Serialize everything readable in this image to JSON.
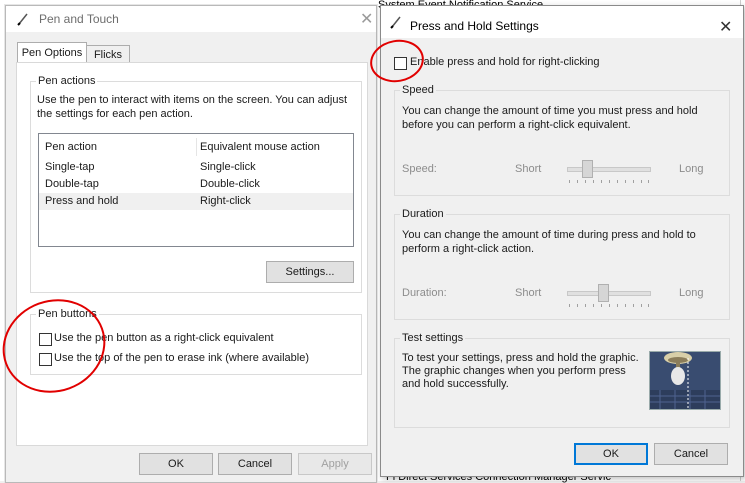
{
  "background": {
    "item_top": "System Event Notification Service",
    "item_bottom": "Fi Direct Services Connection Manager Servic"
  },
  "pen_touch": {
    "title": "Pen and Touch",
    "tabs": [
      "Pen Options",
      "Flicks"
    ],
    "pen_actions": {
      "label": "Pen actions",
      "description": "Use the pen to interact with items on the screen.  You can adjust the settings for each pen action.",
      "columns": [
        "Pen action",
        "Equivalent mouse action"
      ],
      "rows": [
        {
          "action": "Single-tap",
          "mouse": "Single-click"
        },
        {
          "action": "Double-tap",
          "mouse": "Double-click"
        },
        {
          "action": "Press and hold",
          "mouse": "Right-click"
        }
      ],
      "settings_button": "Settings..."
    },
    "pen_buttons": {
      "label": "Pen buttons",
      "option1": "Use the pen button as a right-click equivalent",
      "option2": "Use the top of the pen to erase ink (where available)"
    },
    "buttons": {
      "ok": "OK",
      "cancel": "Cancel",
      "apply": "Apply"
    }
  },
  "press_hold": {
    "title": "Press and Hold Settings",
    "enable_label": "Enable press and hold for right-clicking",
    "speed": {
      "label": "Speed",
      "description": "You can change the amount of time you must press and hold before you can perform a right-click equivalent.",
      "slider_label": "Speed:",
      "min": "Short",
      "max": "Long"
    },
    "duration": {
      "label": "Duration",
      "description": "You can change the amount of time during press and hold to perform a right-click action.",
      "slider_label": "Duration:",
      "min": "Short",
      "max": "Long"
    },
    "test": {
      "label": "Test settings",
      "description": "To test your settings, press and hold the graphic. The graphic changes when you perform press and hold successfully."
    },
    "buttons": {
      "ok": "OK",
      "cancel": "Cancel"
    }
  },
  "colors": {
    "accent": "#0078d7",
    "annotation": "#e10000"
  }
}
